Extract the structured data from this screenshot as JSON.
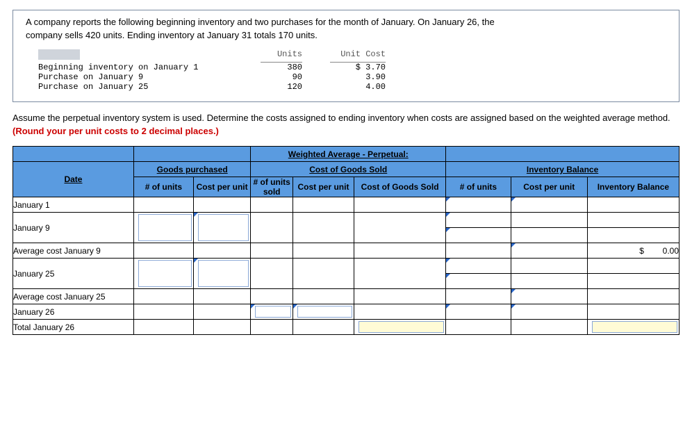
{
  "question": {
    "line1": "A company reports the following beginning inventory and two purchases for the month of January. On January 26, the",
    "line2": "company sells 420 units. Ending inventory at January 31 totals 170 units."
  },
  "data_headers": {
    "units": "Units",
    "unit_cost": "Unit Cost"
  },
  "data_rows": [
    {
      "desc": "Beginning inventory on January 1",
      "units": "380",
      "cost": "$ 3.70"
    },
    {
      "desc": "Purchase on January 9",
      "units": "90",
      "cost": "3.90"
    },
    {
      "desc": "Purchase on January 25",
      "units": "120",
      "cost": "4.00"
    }
  ],
  "instr": {
    "black": "Assume the perpetual inventory system is used. Determine the costs assigned to ending inventory when costs are assigned based on the weighted average method. ",
    "red": "(Round your per unit costs to 2 decimal places.)"
  },
  "headers": {
    "top_center": "Weighted Average - Perpetual:",
    "goods": "Goods purchased",
    "cogs_group": "Cost of Goods Sold",
    "inv_group": "Inventory Balance",
    "date": "Date",
    "n_units": "# of units",
    "cpu": "Cost per unit",
    "n_units_sold": "# of units sold",
    "cpu2": "Cost per unit",
    "cogs": "Cost of Goods Sold",
    "n_units3": "# of units",
    "cpu3": "Cost per unit",
    "inv_bal": "Inventory Balance"
  },
  "rows": {
    "r1": "January 1",
    "r2": "January 9",
    "r3": "Average cost January 9",
    "r4": "January 25",
    "r5": "Average cost January 25",
    "r6": "January 26",
    "r7": "Total January 26"
  },
  "values": {
    "dollar": "$",
    "zero": "0.00"
  }
}
